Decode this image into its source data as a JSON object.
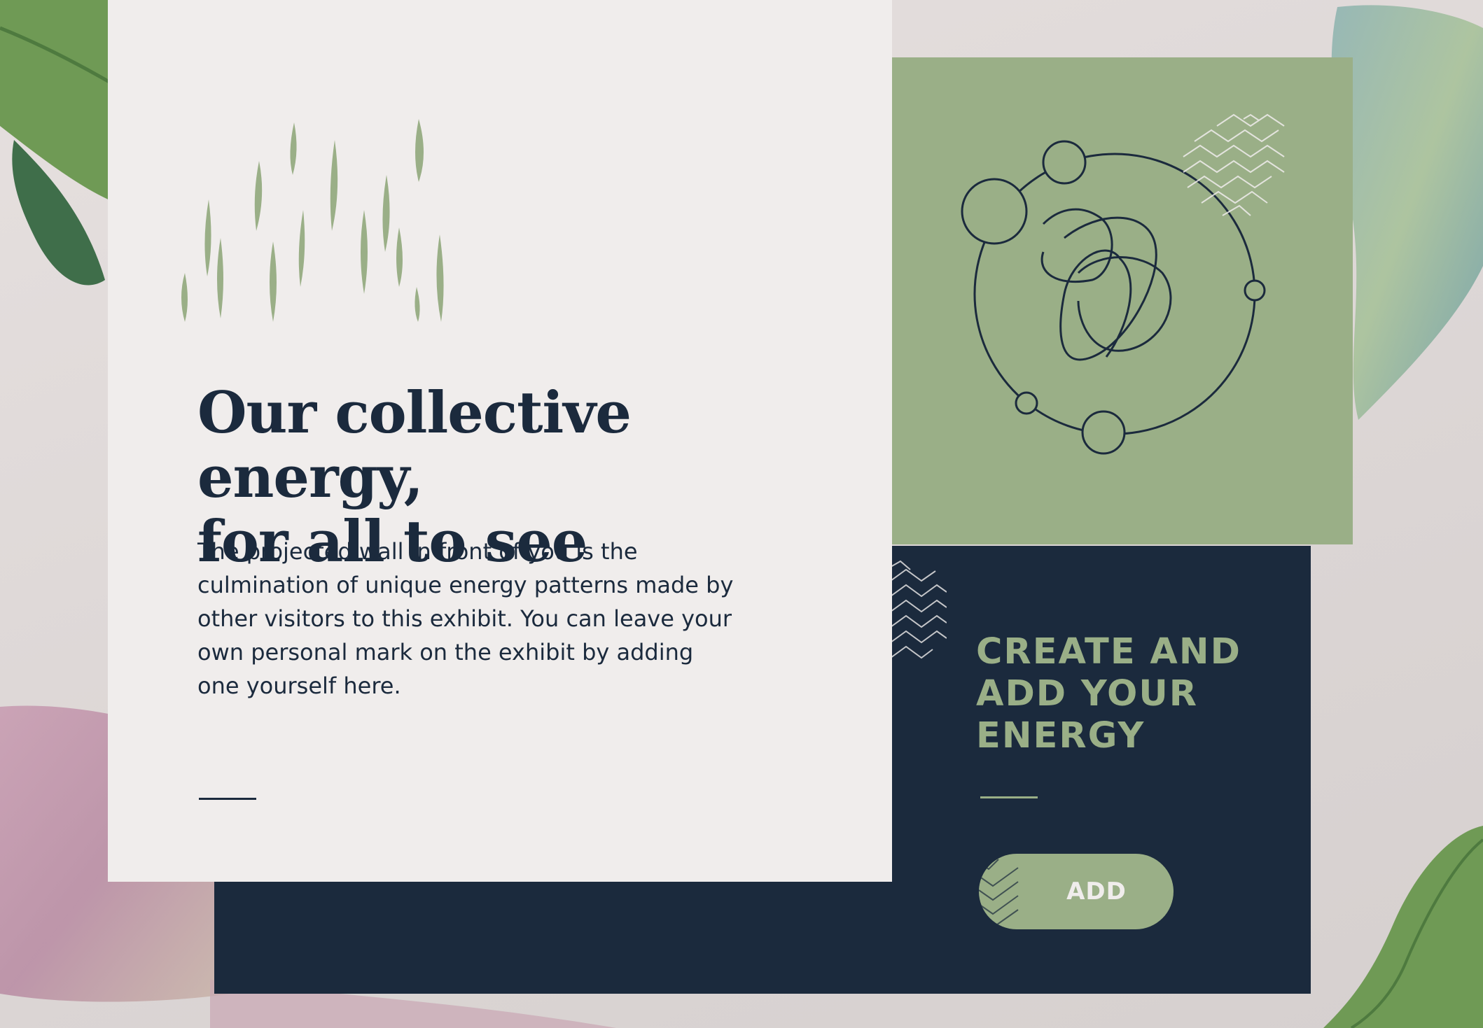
{
  "colors": {
    "navy": "#1b2a3d",
    "sage": "#9aaf87",
    "card": "#f0edec",
    "background": "#ddd7d6"
  },
  "hero": {
    "headline": "Our collective energy,\nfor all to see",
    "body": "The projected wall in front of you is the\nculmination of unique energy patterns made by\nother visitors to this exhibit. You can leave your\nown personal mark on the exhibit by adding\none yourself here."
  },
  "cta": {
    "heading": "CREATE AND\nADD YOUR\nENERGY",
    "button_label": "ADD"
  },
  "icons": {
    "energy_pattern": "energy-orbit-icon",
    "chevron_pattern": "zigzag-chevron-icon"
  }
}
